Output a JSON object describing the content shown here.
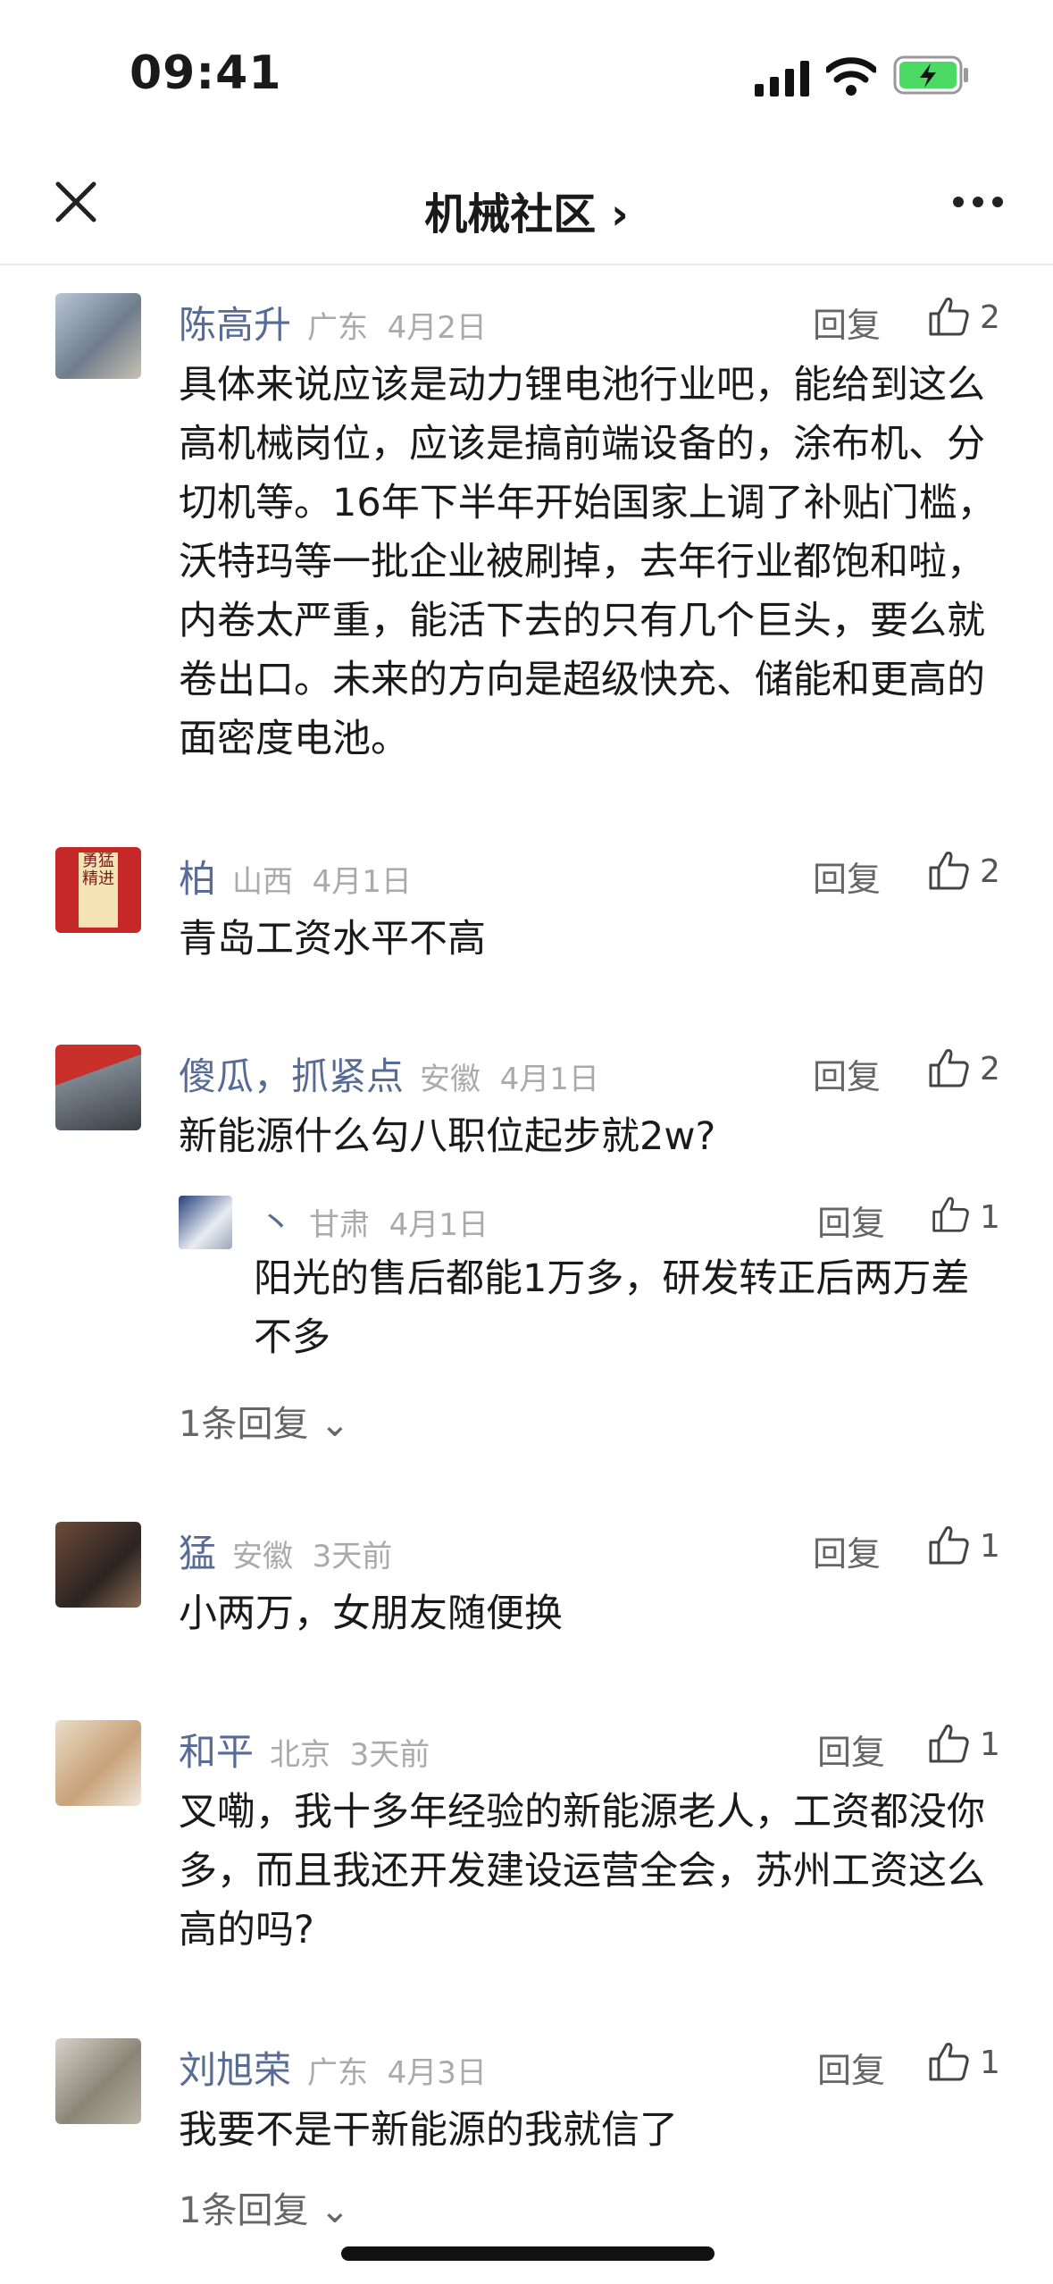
{
  "status": {
    "time": "09:41"
  },
  "nav": {
    "title": "机械社区 ›"
  },
  "ui": {
    "reply": "回复"
  },
  "comments": [
    {
      "name": "陈高升",
      "region": "广东",
      "date": "4月2日",
      "likes": "2",
      "text": "具体来说应该是动力锂电池行业吧，能给到这么高机械岗位，应该是搞前端设备的，涂布机、分切机等。16年下半年开始国家上调了补贴门槛，沃特玛等一批企业被刷掉，去年行业都饱和啦，内卷太严重，能活下去的只有几个巨头，要么就卷出口。未来的方向是超级快充、储能和更高的面密度电池。"
    },
    {
      "name": "柏",
      "region": "山西",
      "date": "4月1日",
      "likes": "2",
      "text": "青岛工资水平不高",
      "avatar_text": "勇猛精进"
    },
    {
      "name": "傻瓜，抓紧点",
      "region": "安徽",
      "date": "4月1日",
      "likes": "2",
      "text": "新能源什么勾八职位起步就2w?",
      "sub": {
        "name": "丶",
        "region": "甘肃",
        "date": "4月1日",
        "likes": "1",
        "text": "阳光的售后都能1万多，研发转正后两万差不多"
      },
      "more_replies": "1条回复 ⌄"
    },
    {
      "name": "猛",
      "region": "安徽",
      "date": "3天前",
      "likes": "1",
      "text": "小两万，女朋友随便换"
    },
    {
      "name": "和平",
      "region": "北京",
      "date": "3天前",
      "likes": "1",
      "text": "叉嘞，我十多年经验的新能源老人，工资都没你多，而且我还开发建设运营全会，苏州工资这么高的吗?"
    },
    {
      "name": "刘旭荣",
      "region": "广东",
      "date": "4月3日",
      "likes": "1",
      "text": "我要不是干新能源的我就信了",
      "more_replies": "1条回复 ⌄"
    }
  ]
}
